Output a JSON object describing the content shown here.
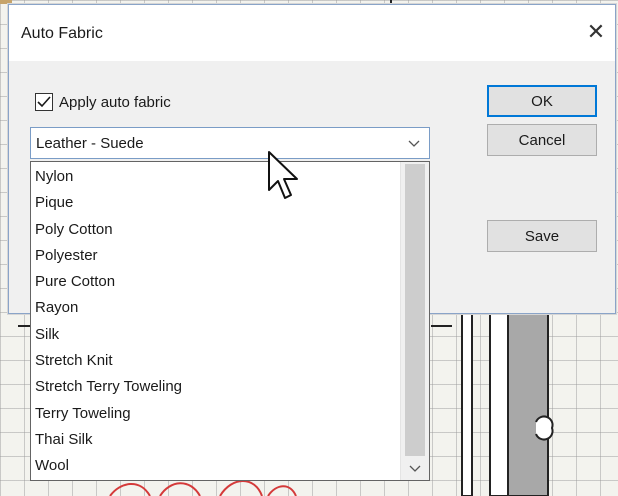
{
  "dialog": {
    "title": "Auto Fabric",
    "close_glyph": "✕",
    "apply_checkbox": {
      "label": "Apply auto fabric",
      "checked": true,
      "icon": "check-icon"
    },
    "buttons": {
      "ok": "OK",
      "cancel": "Cancel",
      "save": "Save"
    },
    "fabric_select": {
      "selected": "Leather - Suede",
      "arrow_icon": "chevron-down-icon"
    },
    "fabric_options": [
      "Nylon",
      "Pique",
      "Poly Cotton",
      "Polyester",
      "Pure Cotton",
      "Rayon",
      "Silk",
      "Stretch Knit",
      "Stretch Terry Toweling",
      "Terry Toweling",
      "Thai Silk",
      "Wool"
    ]
  },
  "colors": {
    "accent": "#0078d7",
    "combo_border": "#7a9cc6",
    "pattern_red": "#d43a3a"
  }
}
